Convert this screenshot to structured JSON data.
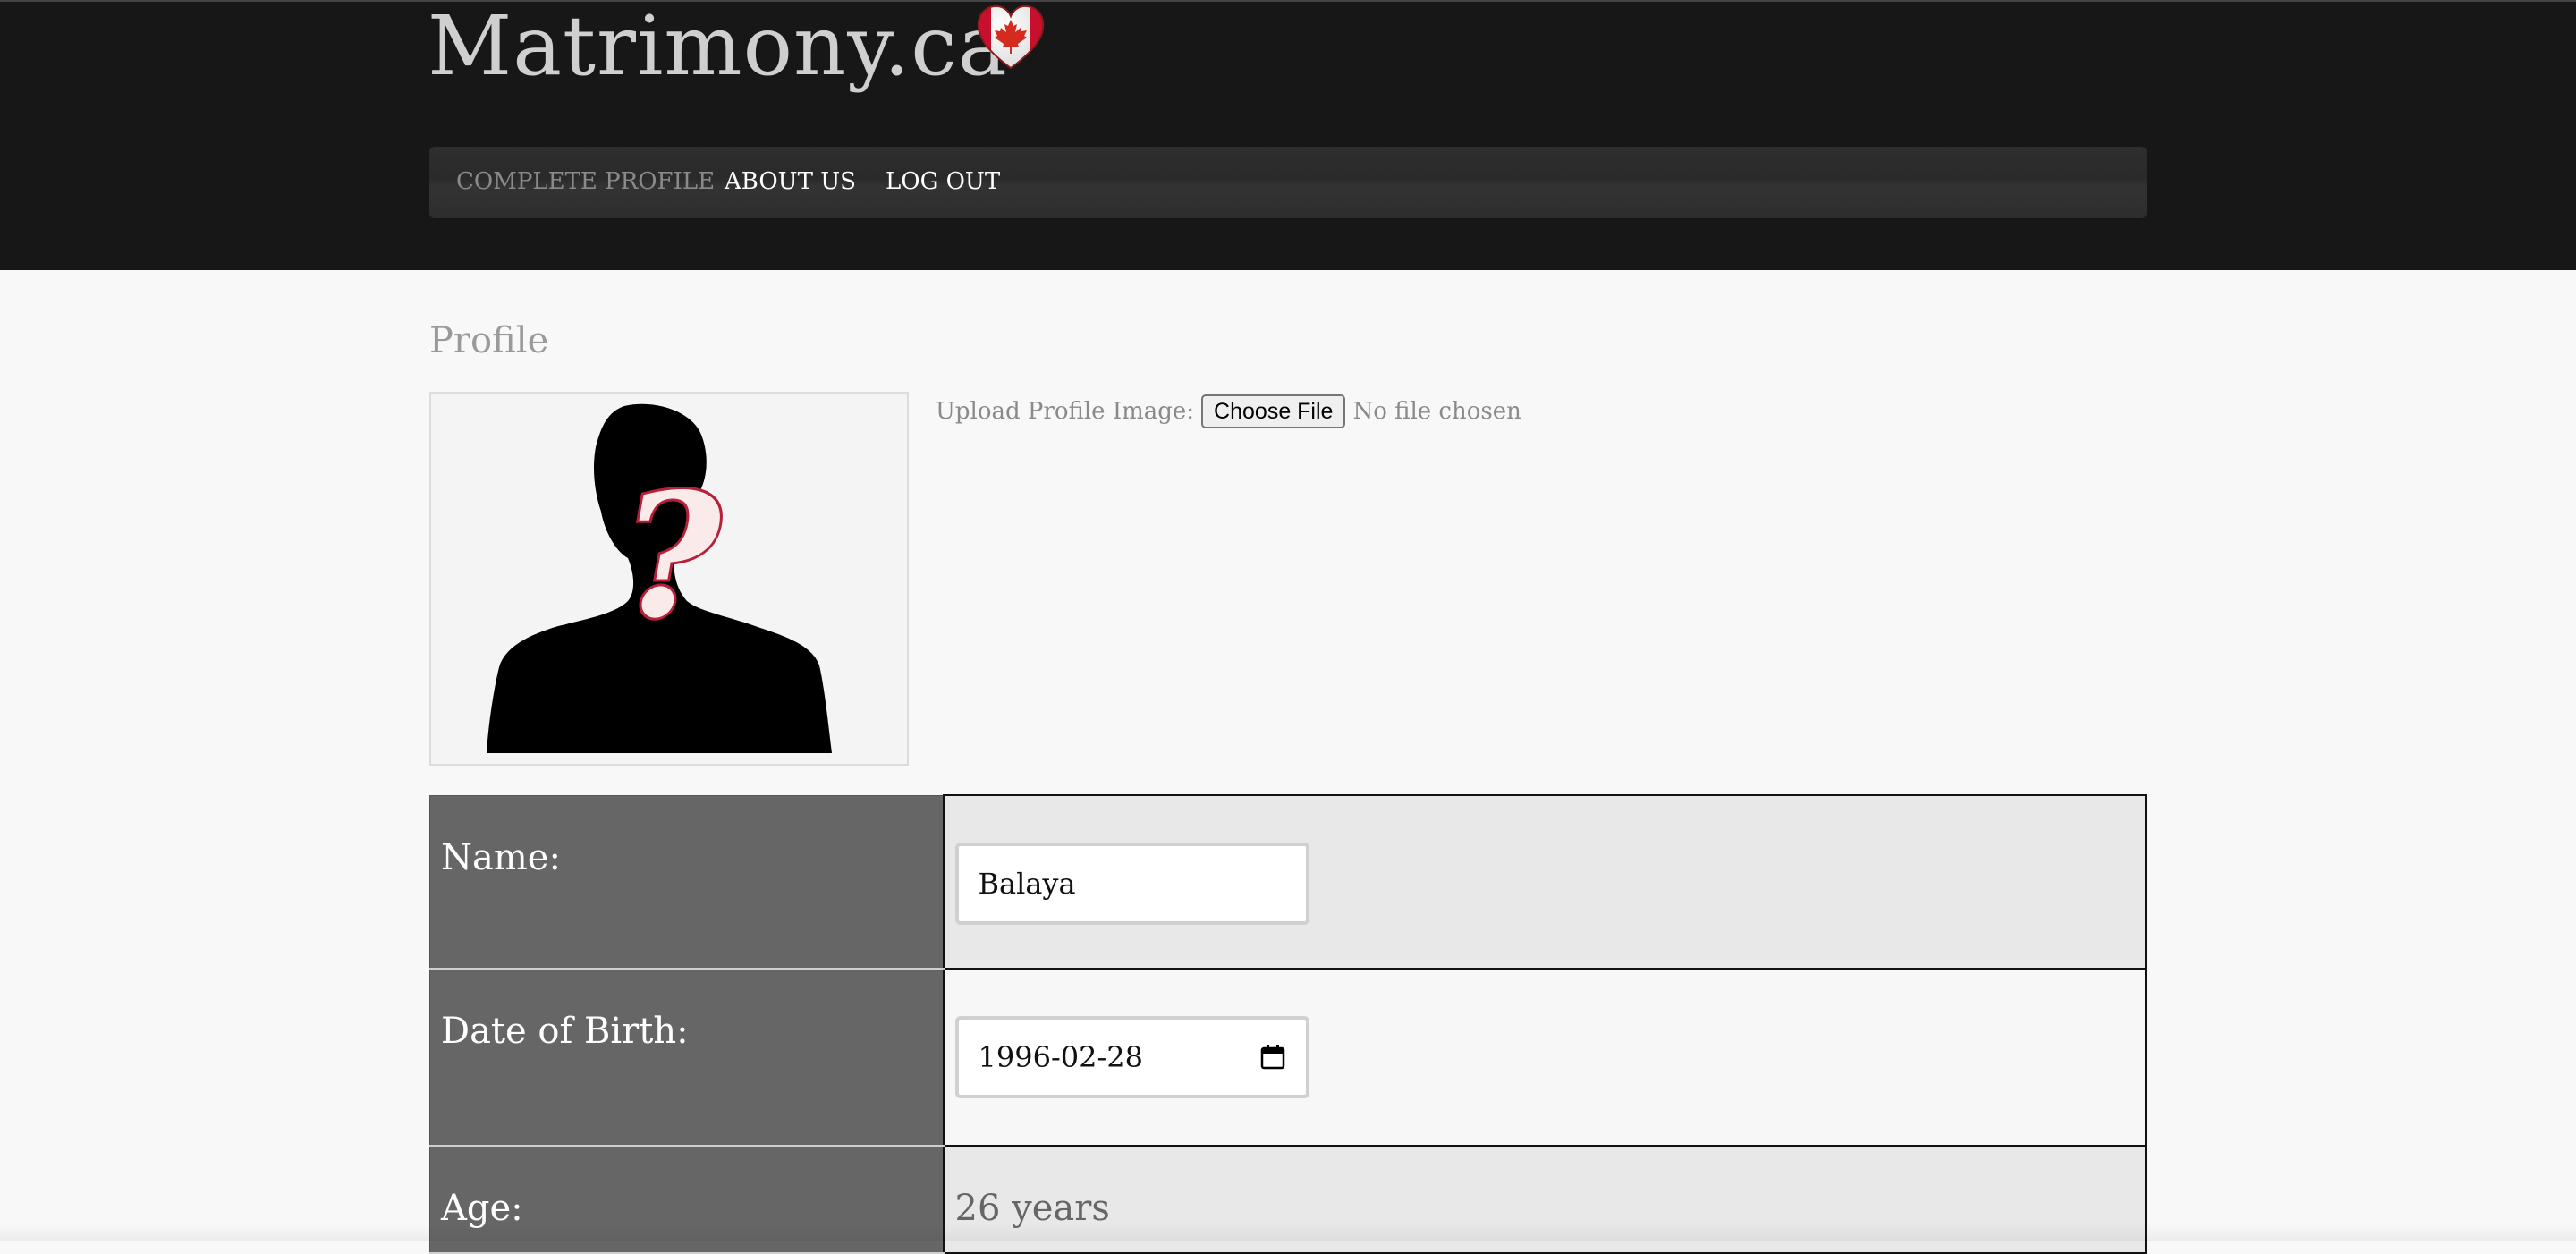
{
  "header": {
    "brand": "Matrimony.ca",
    "brand_icon": "canada-heart-icon"
  },
  "nav": {
    "items": [
      {
        "label": "COMPLETE PROFILE",
        "active": true
      },
      {
        "label": "ABOUT US",
        "active": false
      },
      {
        "label": "LOG OUT",
        "active": false
      }
    ]
  },
  "profile": {
    "title": "Profile",
    "avatar_icon": "unknown-person-silhouette-icon",
    "upload_label": "Upload Profile Image:",
    "choose_file_label": "Choose File",
    "no_file_text": "No file chosen"
  },
  "form": {
    "rows": [
      {
        "label": "Name:",
        "value": "Balaya",
        "type": "text"
      },
      {
        "label": "Date of Birth:",
        "value": "1996-02-28",
        "type": "date"
      },
      {
        "label": "Age:",
        "value": "26 years",
        "type": "static"
      }
    ]
  },
  "colors": {
    "header_bg": "#171717",
    "label_bg": "#666666",
    "accent_red": "#d52b1e"
  }
}
